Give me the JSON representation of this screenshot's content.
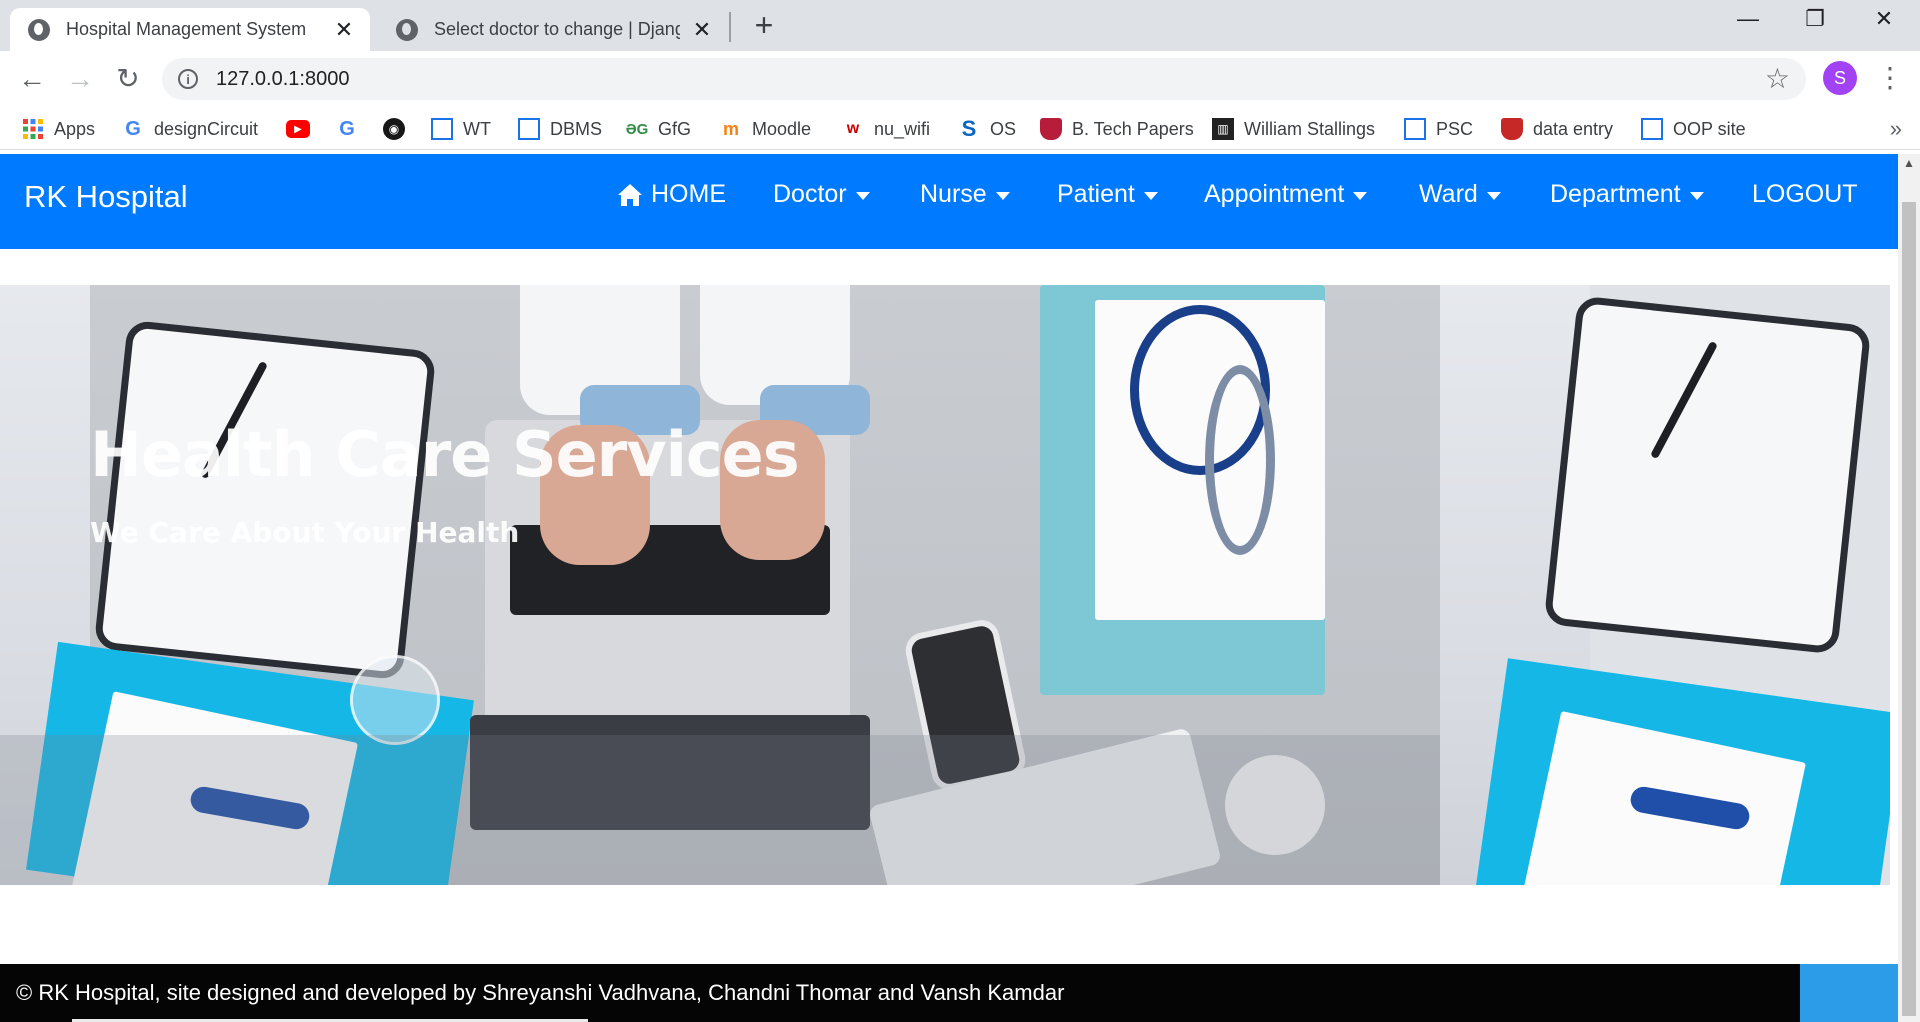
{
  "browser": {
    "tabs": [
      {
        "title": "Hospital Management System",
        "active": true
      },
      {
        "title": "Select doctor to change | Django",
        "active": false
      }
    ],
    "url": "127.0.0.1:8000",
    "profile_initial": "S",
    "bookmarks": [
      {
        "label": "Apps",
        "icon": "apps-grid-icon"
      },
      {
        "label": "designCircuit",
        "icon": "google-icon"
      },
      {
        "label": "",
        "icon": "youtube-icon"
      },
      {
        "label": "",
        "icon": "google-icon"
      },
      {
        "label": "",
        "icon": "github-icon"
      },
      {
        "label": "WT",
        "icon": "window-icon"
      },
      {
        "label": "DBMS",
        "icon": "window-icon"
      },
      {
        "label": "GfG",
        "icon": "gfg-icon"
      },
      {
        "label": "Moodle",
        "icon": "moodle-icon"
      },
      {
        "label": "nu_wifi",
        "icon": "nu-icon"
      },
      {
        "label": "OS",
        "icon": "s-icon"
      },
      {
        "label": "B. Tech Papers",
        "icon": "shield-icon"
      },
      {
        "label": "William Stallings",
        "icon": "building-icon"
      },
      {
        "label": "PSC",
        "icon": "window-icon"
      },
      {
        "label": "data entry",
        "icon": "shield-icon"
      },
      {
        "label": "OOP site",
        "icon": "window-icon"
      }
    ]
  },
  "site": {
    "brand": "RK Hospital",
    "nav": [
      {
        "label": "HOME",
        "dropdown": false
      },
      {
        "label": "Doctor",
        "dropdown": true
      },
      {
        "label": "Nurse",
        "dropdown": true
      },
      {
        "label": "Patient",
        "dropdown": true
      },
      {
        "label": "Appointment",
        "dropdown": true
      },
      {
        "label": "Ward",
        "dropdown": true
      },
      {
        "label": "Department",
        "dropdown": true
      },
      {
        "label": "LOGOUT",
        "dropdown": false
      }
    ],
    "hero": {
      "title": "Health Care Services",
      "subtitle": "We Care About Your Health"
    },
    "footer": "© RK Hospital, site designed and developed by Shreyanshi Vadhvana, Chandni Thomar and Vansh Kamdar",
    "colors": {
      "nav": "#007bff",
      "footer": "#050505",
      "accent": "#2c9be8"
    }
  }
}
